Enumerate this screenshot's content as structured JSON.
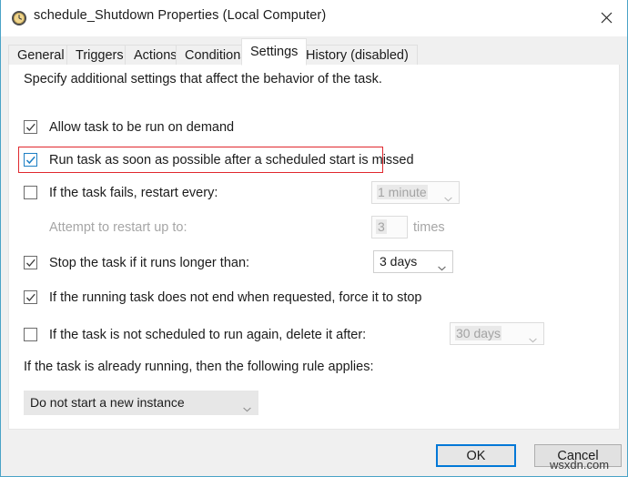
{
  "window": {
    "title": "schedule_Shutdown Properties (Local Computer)",
    "icon": "task-scheduler-clock-icon",
    "close_label": "✕",
    "border_color": "#4aa3c7"
  },
  "tabs": [
    {
      "label": "General",
      "active": false,
      "disabled": false
    },
    {
      "label": "Triggers",
      "active": false,
      "disabled": false
    },
    {
      "label": "Actions",
      "active": false,
      "disabled": false
    },
    {
      "label": "Conditions",
      "active": false,
      "disabled": false
    },
    {
      "label": "Settings",
      "active": true,
      "disabled": false
    },
    {
      "label": "History (disabled)",
      "active": false,
      "disabled": true
    }
  ],
  "settings": {
    "intro": "Specify additional settings that affect the behavior of the task.",
    "rows": {
      "allow_on_demand": {
        "label": "Allow task to be run on demand",
        "checked": true,
        "state": "enabled"
      },
      "run_asap_missed": {
        "label": "Run task as soon as possible after a scheduled start is missed",
        "checked": true,
        "state": "enabled",
        "highlighted": true
      },
      "restart_on_fail": {
        "label": "If the task fails, restart every:",
        "checked": false,
        "state": "enabled",
        "value": "1 minute",
        "value_enabled": false
      },
      "restart_attempts": {
        "label": "Attempt to restart up to:",
        "state": "disabled",
        "value": "3",
        "suffix": "times"
      },
      "stop_if_longer": {
        "label": "Stop the task if it runs longer than:",
        "checked": true,
        "state": "enabled",
        "value": "3 days",
        "value_enabled": true
      },
      "force_stop": {
        "label": "If the running task does not end when requested, force it to stop",
        "checked": true,
        "state": "enabled"
      },
      "delete_after": {
        "label": "If the task is not scheduled to run again, delete it after:",
        "checked": false,
        "state": "enabled",
        "value": "30 days",
        "value_enabled": false
      }
    },
    "already_running": {
      "label": "If the task is already running, then the following rule applies:",
      "selected": "Do not start a new instance"
    }
  },
  "footer": {
    "ok_label": "OK",
    "cancel_label": "Cancel",
    "focused_button": "OK"
  },
  "watermark": {
    "text": "wsxdn.com"
  },
  "colors": {
    "accent": "#0078d7",
    "annotation": "#e0282e",
    "checkbox_blue": "#1d7fc4",
    "disabled_text": "#a6a6a6"
  }
}
